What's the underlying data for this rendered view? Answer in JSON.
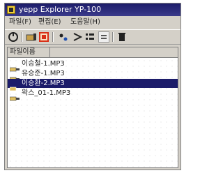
{
  "window": {
    "title": "yepp Explorer YP-100"
  },
  "menubar": {
    "items": [
      "파일(F)",
      "편집(E)",
      "도움말(H)"
    ]
  },
  "toolbar": {
    "buttons": [
      "connect-icon",
      "folder-download-icon",
      "record-icon",
      "move-icon",
      "sort-icon",
      "list-icon",
      "view-icon",
      "delete-icon"
    ]
  },
  "file_list": {
    "column_header": "파일이름",
    "files": [
      {
        "name": "이승철-1.MP3",
        "selected": false
      },
      {
        "name": "유승준-1.MP3",
        "selected": false
      },
      {
        "name": "이승환-2.MP3",
        "selected": true
      },
      {
        "name": "왁스_01-1.MP3",
        "selected": false
      }
    ]
  },
  "colors": {
    "title_bar": "#1c1c6a",
    "selection": "#1c1c6a",
    "window_bg": "#d4d0c8"
  }
}
